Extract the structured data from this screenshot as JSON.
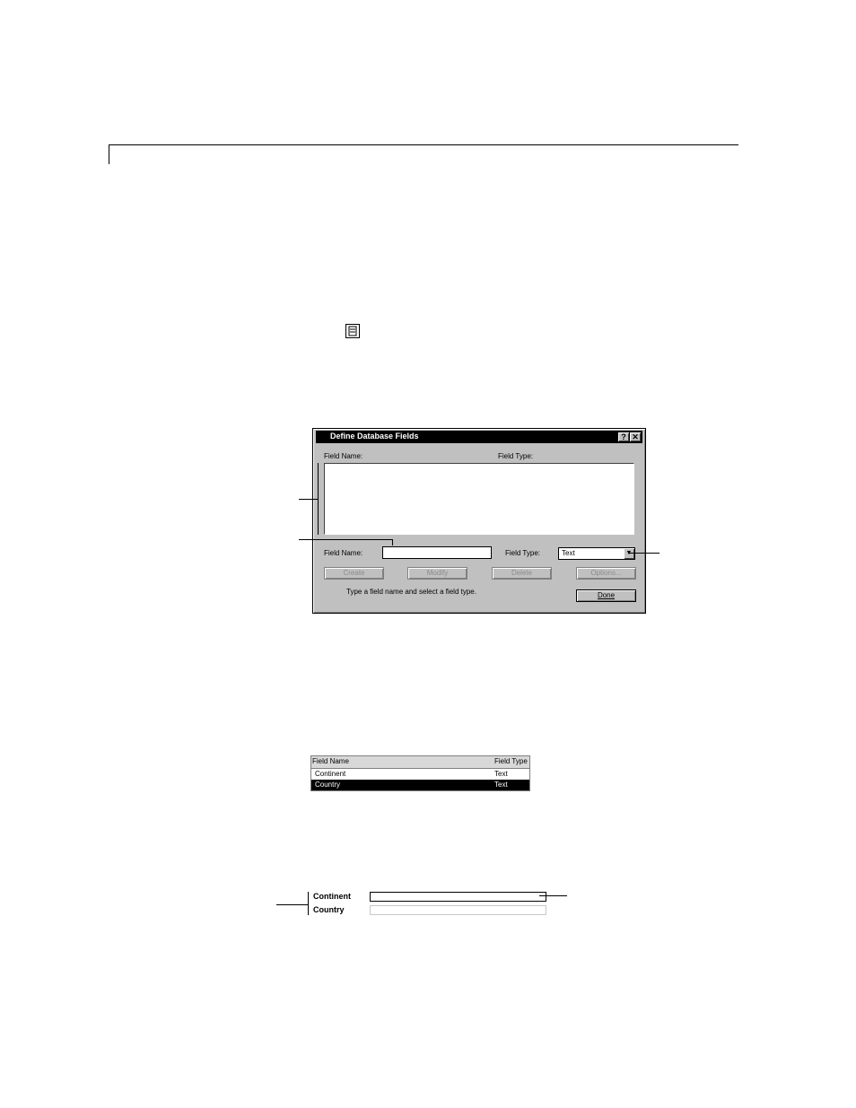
{
  "toolbar_icon": "database-icon",
  "dialog": {
    "title": "Define Database Fields",
    "help_glyph": "?",
    "close_glyph": "✕",
    "list_header_name": "Field Name:",
    "list_header_type": "Field Type:",
    "field_name_label": "Field Name:",
    "field_type_label": "Field Type:",
    "field_type_value": "Text",
    "field_name_value": "",
    "buttons": {
      "create": "Create",
      "modify": "Modify",
      "delete": "Delete",
      "options": "Options...",
      "done": "Done"
    },
    "status_text": "Type a field name and select a field type."
  },
  "fields_list": {
    "header_name": "Field Name",
    "header_type": "Field Type",
    "rows": [
      {
        "name": "Continent",
        "type": "Text",
        "selected": false
      },
      {
        "name": "Country",
        "type": "Text",
        "selected": true
      }
    ]
  },
  "form": {
    "labels": [
      "Continent",
      "Country"
    ]
  }
}
